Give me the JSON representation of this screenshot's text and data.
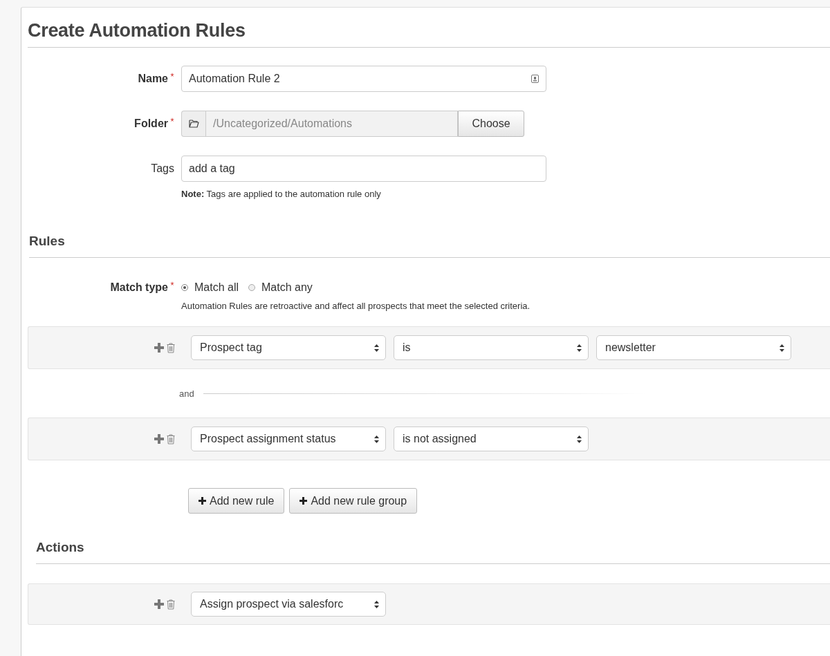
{
  "title": "Create Automation Rules",
  "fields": [
    {
      "kind": "text",
      "label": "Name",
      "required": true,
      "value": "Automation Rule 2"
    },
    {
      "kind": "folder",
      "label": "Folder",
      "required": true,
      "value": "/Uncategorized/Automations",
      "button": "Choose"
    },
    {
      "kind": "tags",
      "label": "Tags",
      "required": false,
      "placeholder": "add a tag",
      "note_bold": "Note:",
      "note": "Tags are applied to the automation rule only"
    }
  ],
  "rules": {
    "heading": "Rules",
    "match_label": "Match type",
    "match_required": true,
    "match_options": [
      {
        "label": "Match all",
        "selected": true
      },
      {
        "label": "Match any",
        "selected": false
      }
    ],
    "description": "Automation Rules are retroactive and affect all prospects that meet the selected criteria.",
    "rows": [
      {
        "selects": [
          "Prospect tag",
          "is",
          "newsletter"
        ]
      },
      {
        "selects": [
          "Prospect assignment status",
          "is not assigned"
        ]
      }
    ],
    "connector": "and",
    "buttons": [
      "Add new rule",
      "Add new rule group"
    ]
  },
  "actions": {
    "heading": "Actions",
    "rows": [
      {
        "selects": [
          "Assign prospect via salesforc"
        ]
      }
    ]
  }
}
